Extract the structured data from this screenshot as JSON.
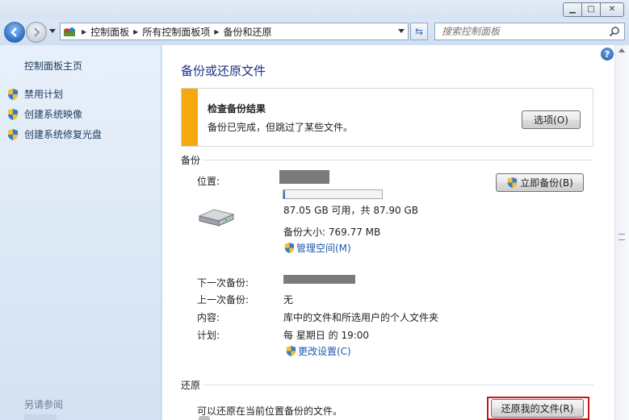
{
  "titlebar": {
    "minimize_glyph": "▁",
    "maximize_glyph": "□",
    "close_glyph": "✕"
  },
  "navbar": {
    "breadcrumbs": [
      "控制面板",
      "所有控制面板项",
      "备份和还原"
    ],
    "search_placeholder": "搜索控制面板"
  },
  "sidebar": {
    "home": "控制面板主页",
    "links": [
      {
        "label": "禁用计划",
        "icon": "shield-icon"
      },
      {
        "label": "创建系统映像",
        "icon": "shield-icon"
      },
      {
        "label": "创建系统修复光盘",
        "icon": "shield-icon"
      }
    ],
    "see_also": "另请参阅"
  },
  "main": {
    "title": "备份或还原文件",
    "notice": {
      "title": "检查备份结果",
      "text": "备份已完成，但跳过了某些文件。",
      "button": "选项(O)",
      "accent": "#f5a90e"
    },
    "backup": {
      "section": "备份",
      "location_label": "位置:",
      "usage": "87.05 GB 可用，共 87.90 GB",
      "used_fraction": 0.01,
      "size_text": "备份大小: 769.77 MB",
      "manage_space": "管理空间(M)",
      "backup_now": "立即备份(B)",
      "next_label": "下一次备份:",
      "last_label": "上一次备份:",
      "last_value": "无",
      "contents_label": "内容:",
      "contents_value": "库中的文件和所选用户的个人文件夹",
      "schedule_label": "计划:",
      "schedule_value": "每 星期日 的 19:00",
      "change_settings": "更改设置(C)"
    },
    "restore": {
      "section": "还原",
      "text": "可以还原在当前位置备份的文件。",
      "button": "还原我的文件(R)",
      "highlight_color": "#c8141e"
    }
  }
}
